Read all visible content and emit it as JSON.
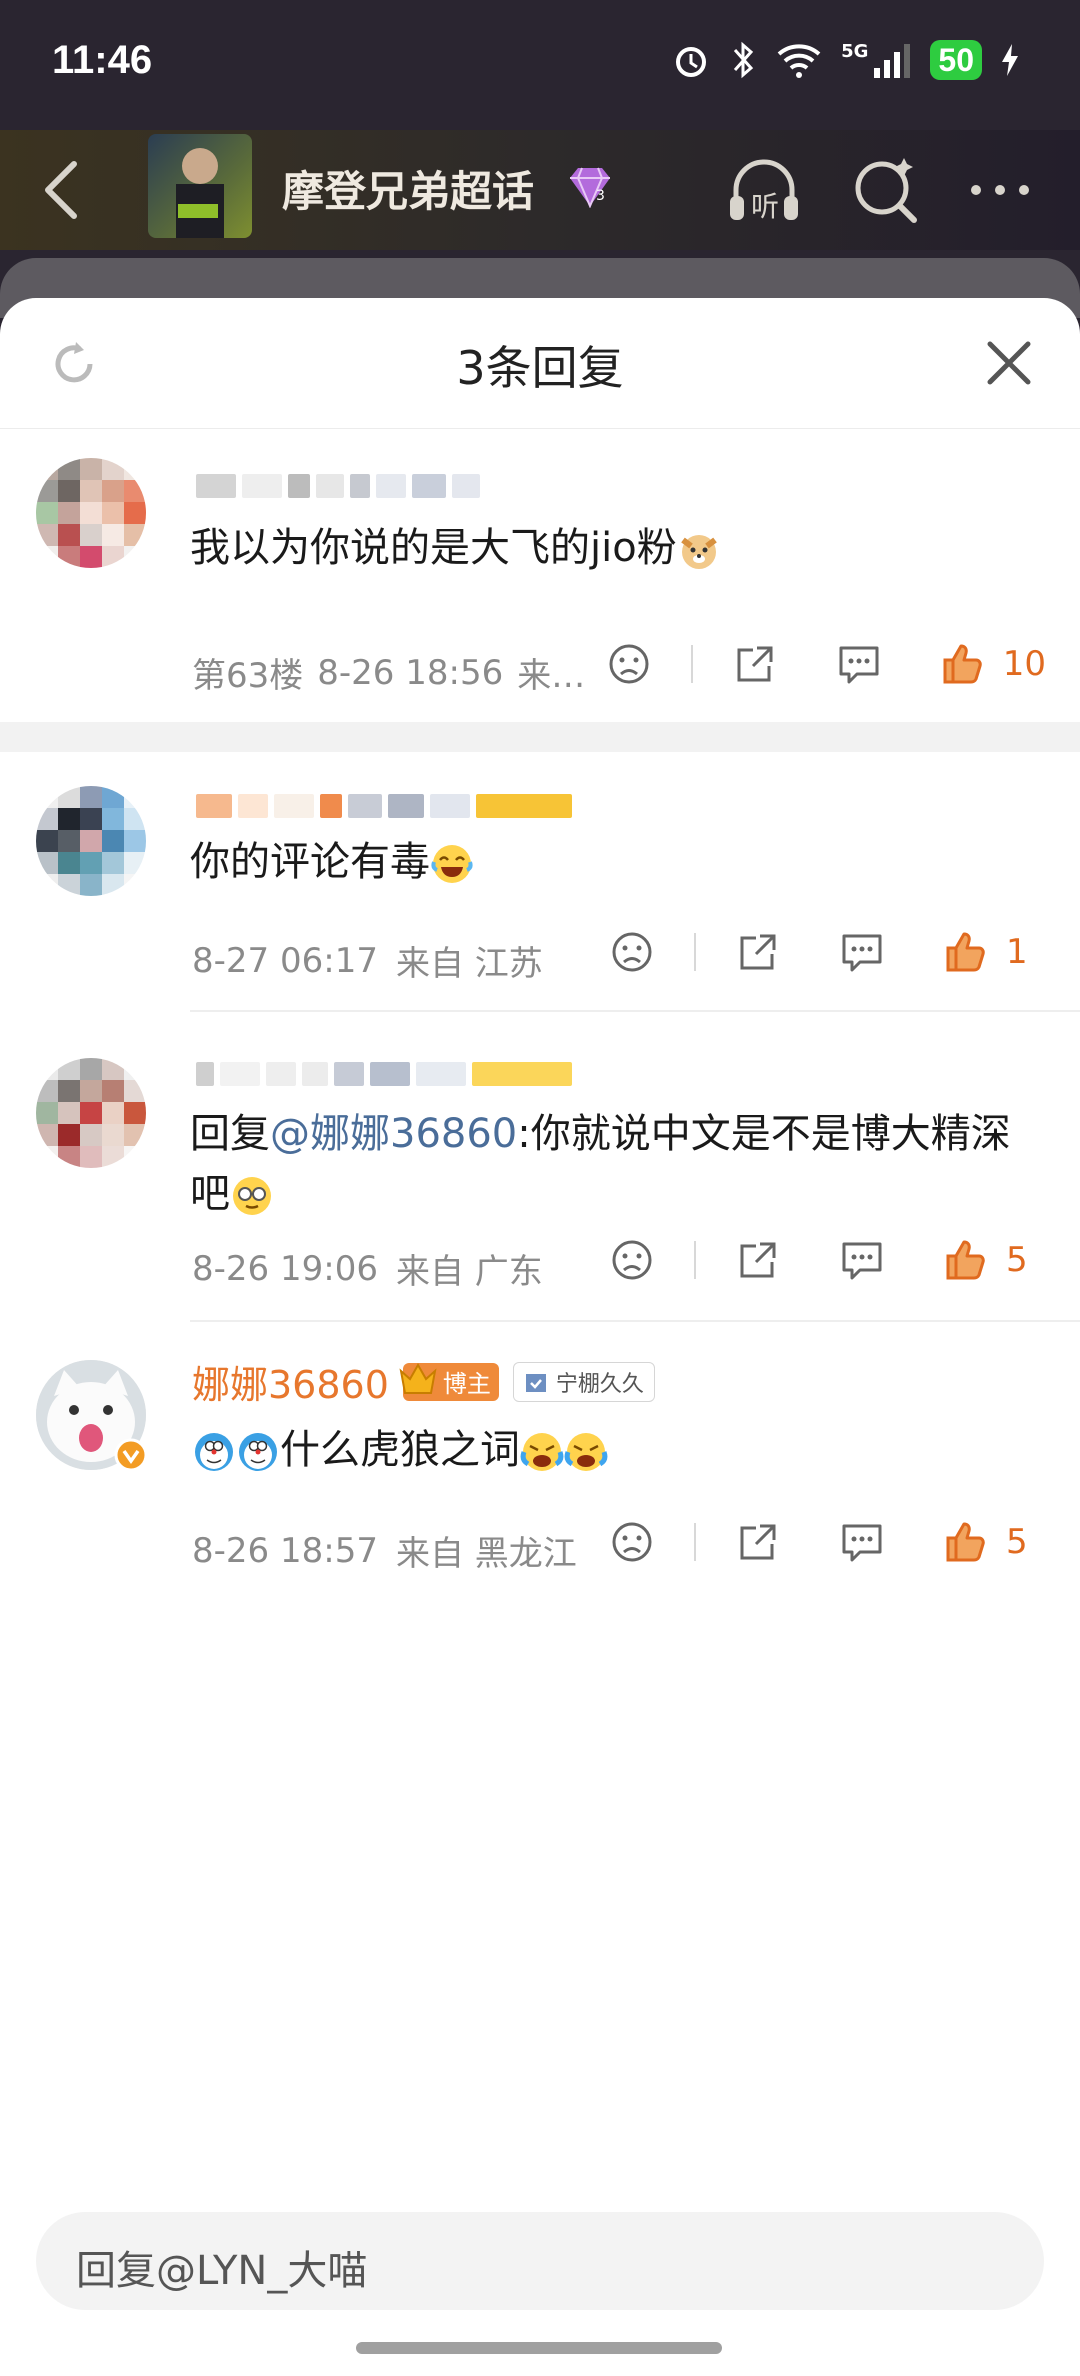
{
  "status": {
    "time": "11:46",
    "battery": "50",
    "network": "5G"
  },
  "header": {
    "topic": "摩登兄弟超话",
    "level": "3"
  },
  "sheet": {
    "title": "3条回复"
  },
  "comments": [
    {
      "text": "我以为你说的是大飞的jio粉",
      "floor": "第63楼",
      "time": "8-26 18:56",
      "location": "来…",
      "likes": "10"
    },
    {
      "text": "你的评论有毒",
      "time": "8-27 06:17",
      "location": "来自 江苏",
      "likes": "1"
    },
    {
      "reply_prefix": "回复",
      "mention": "@娜娜36860",
      "text": ":你就说中文是不是博大精深吧",
      "time": "8-26 19:06",
      "location": "来自 广东",
      "likes": "5"
    },
    {
      "username": "娜娜36860",
      "badge": "博主",
      "group": "宁棚久久",
      "text": "什么虎狼之词",
      "time": "8-26 18:57",
      "location": "来自 黑龙江",
      "likes": "5"
    }
  ],
  "reply_input": {
    "placeholder": "回复@LYN_大喵"
  },
  "colors": {
    "accent": "#e06a1f",
    "mention": "#4a6d99",
    "badge": "#ef8a3a"
  },
  "icons": [
    "back-arrow-icon",
    "listen-icon",
    "search-icon",
    "more-icon",
    "refresh-icon",
    "close-icon",
    "dislike-icon",
    "share-icon",
    "comment-icon",
    "like-icon"
  ]
}
